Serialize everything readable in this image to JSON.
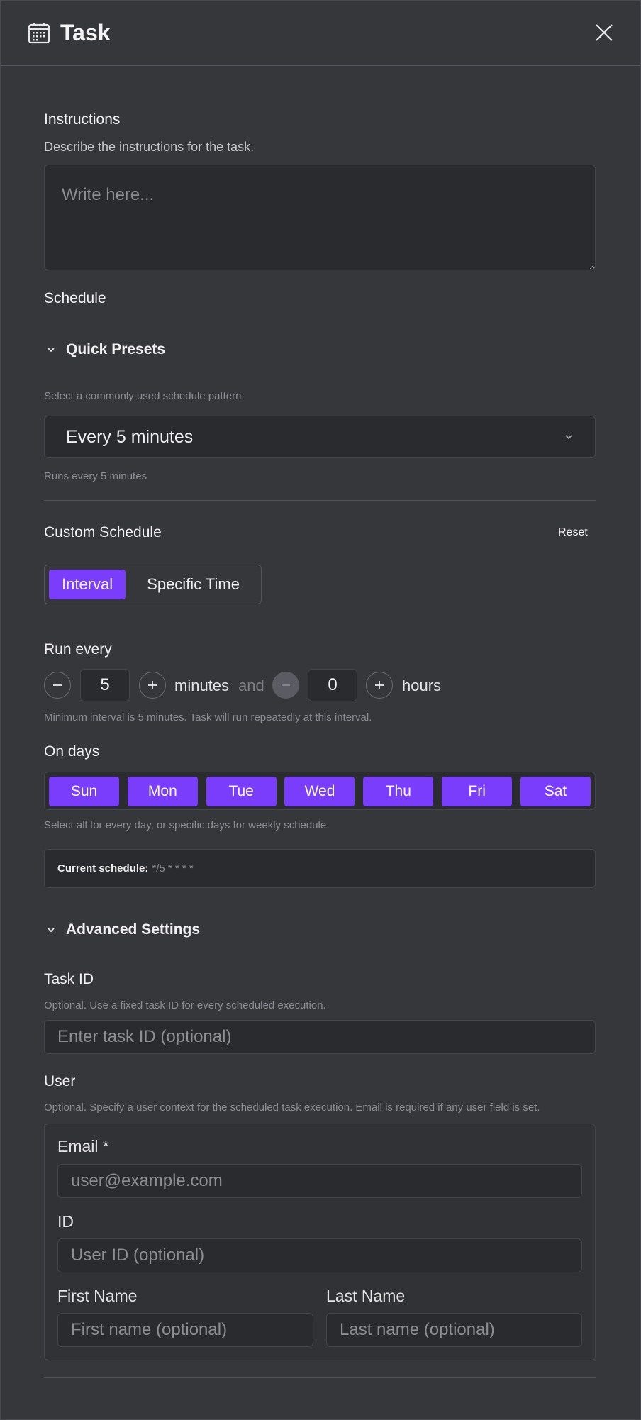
{
  "header": {
    "title": "Task",
    "icon": "calendar-icon",
    "close_icon": "close-icon"
  },
  "instructions": {
    "label": "Instructions",
    "description": "Describe the instructions for the task.",
    "placeholder": "Write here..."
  },
  "schedule": {
    "label": "Schedule",
    "quick_presets": {
      "label": "Quick Presets",
      "hint": "Select a commonly used schedule pattern",
      "selected": "Every 5 minutes",
      "description": "Runs every 5 minutes"
    },
    "custom": {
      "label": "Custom Schedule",
      "reset_label": "Reset",
      "tabs": [
        {
          "label": "Interval",
          "active": true
        },
        {
          "label": "Specific Time",
          "active": false
        }
      ],
      "run_every_label": "Run every",
      "minutes_value": "5",
      "minutes_unit": "minutes",
      "and_label": "and",
      "hours_value": "0",
      "hours_unit": "hours",
      "interval_hint": "Minimum interval is 5 minutes. Task will run repeatedly at this interval.",
      "on_days_label": "On days",
      "days": [
        "Sun",
        "Mon",
        "Tue",
        "Wed",
        "Thu",
        "Fri",
        "Sat"
      ],
      "days_hint": "Select all for every day, or specific days for weekly schedule",
      "current_label": "Current schedule:",
      "current_value": "*/5 * * * *"
    }
  },
  "advanced": {
    "label": "Advanced Settings",
    "task_id": {
      "label": "Task ID",
      "hint": "Optional. Use a fixed task ID for every scheduled execution.",
      "placeholder": "Enter task ID (optional)"
    },
    "user": {
      "label": "User",
      "hint": "Optional. Specify a user context for the scheduled task execution. Email is required if any user field is set.",
      "email_label": "Email *",
      "email_placeholder": "user@example.com",
      "id_label": "ID",
      "id_placeholder": "User ID (optional)",
      "first_name_label": "First Name",
      "first_name_placeholder": "First name (optional)",
      "last_name_label": "Last Name",
      "last_name_placeholder": "Last name (optional)"
    }
  },
  "colors": {
    "accent": "#7a3dfb",
    "background": "#36373b",
    "field": "#2a2b2e"
  }
}
